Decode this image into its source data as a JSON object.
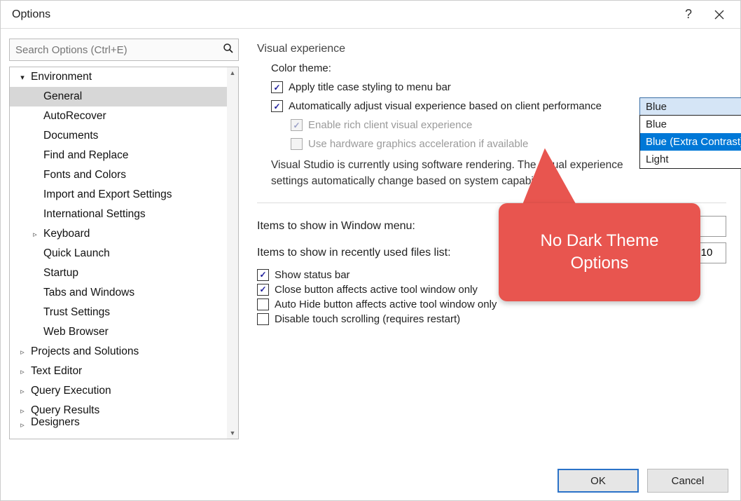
{
  "window": {
    "title": "Options",
    "help_label": "?",
    "close_label": "×"
  },
  "search": {
    "placeholder": "Search Options (Ctrl+E)"
  },
  "tree": {
    "items": [
      {
        "label": "Environment",
        "depth": 0,
        "exp": "▾",
        "solid": true
      },
      {
        "label": "General",
        "depth": 1,
        "selected": true
      },
      {
        "label": "AutoRecover",
        "depth": 1
      },
      {
        "label": "Documents",
        "depth": 1
      },
      {
        "label": "Find and Replace",
        "depth": 1
      },
      {
        "label": "Fonts and Colors",
        "depth": 1
      },
      {
        "label": "Import and Export Settings",
        "depth": 1
      },
      {
        "label": "International Settings",
        "depth": 1
      },
      {
        "label": "Keyboard",
        "depth": 1,
        "exp": "▹"
      },
      {
        "label": "Quick Launch",
        "depth": 1
      },
      {
        "label": "Startup",
        "depth": 1
      },
      {
        "label": "Tabs and Windows",
        "depth": 1
      },
      {
        "label": "Trust Settings",
        "depth": 1
      },
      {
        "label": "Web Browser",
        "depth": 1
      },
      {
        "label": "Projects and Solutions",
        "depth": 0,
        "exp": "▹"
      },
      {
        "label": "Text Editor",
        "depth": 0,
        "exp": "▹"
      },
      {
        "label": "Query Execution",
        "depth": 0,
        "exp": "▹"
      },
      {
        "label": "Query Results",
        "depth": 0,
        "exp": "▹"
      },
      {
        "label": "Designers",
        "depth": 0,
        "exp": "▹",
        "cut": true
      }
    ]
  },
  "visual": {
    "group_title": "Visual experience",
    "color_theme_label": "Color theme:",
    "color_theme_value": "Blue",
    "dropdown_options": [
      "Blue",
      "Blue (Extra Contrast)",
      "Light"
    ],
    "dropdown_hover_index": 1,
    "apply_title_case": {
      "label": "Apply title case styling to menu bar",
      "checked": true
    },
    "auto_adjust": {
      "label": "Automatically adjust visual experience based on client performance",
      "checked": true
    },
    "enable_rich": {
      "label": "Enable rich client visual experience",
      "checked": true
    },
    "use_hw": {
      "label": "Use hardware graphics acceleration if available",
      "checked": false
    },
    "desc_line1": "Visual Studio is currently using software rendering. The visual experience",
    "desc_line2": "settings automatically change based on system capabilities."
  },
  "fields": {
    "window_menu_label": "Items to show in Window menu:",
    "window_menu_value": "",
    "recent_files_label": "Items to show in recently used files list:",
    "recent_files_value": "10"
  },
  "checks": {
    "show_status_bar": {
      "label": "Show status bar",
      "checked": true
    },
    "close_btn_active": {
      "label": "Close button affects active tool window only",
      "checked": true
    },
    "autohide_active": {
      "label": "Auto Hide button affects active tool window only",
      "checked": false
    },
    "disable_touch": {
      "label": "Disable touch scrolling (requires restart)",
      "checked": false
    }
  },
  "buttons": {
    "ok": "OK",
    "cancel": "Cancel"
  },
  "callout": {
    "text": "No Dark Theme Options"
  }
}
